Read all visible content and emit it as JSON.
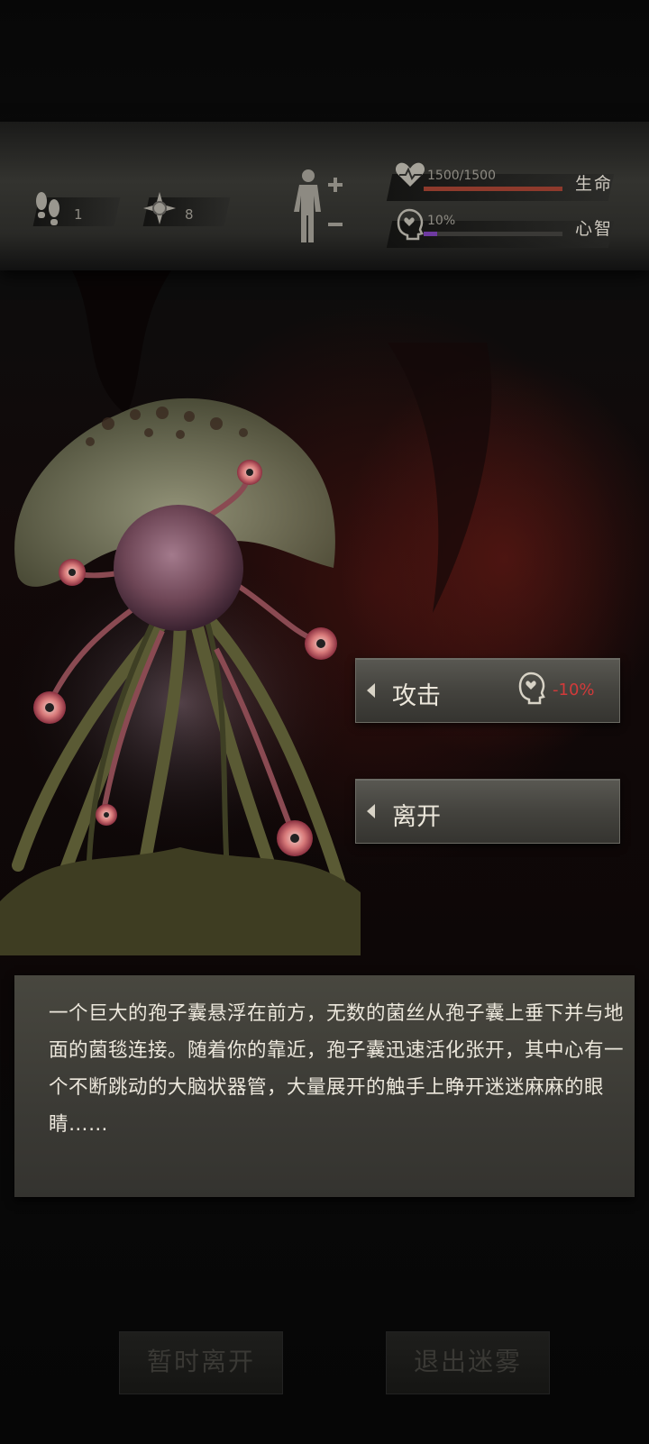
{
  "hud": {
    "steps": {
      "icon": "footprints-icon",
      "value": "1"
    },
    "compass": {
      "icon": "compass-icon",
      "value": "8"
    },
    "character_icon": "character-body-icon",
    "health": {
      "icon": "heart-pulse-icon",
      "text": "1500/1500",
      "label": "生命",
      "fraction": 1.0,
      "color": "#8e3a2c"
    },
    "sanity": {
      "icon": "head-brain-icon",
      "text": "10%",
      "label": "心智",
      "fraction": 0.1,
      "color": "#6e3aa0"
    }
  },
  "choices": [
    {
      "label": "攻击",
      "cost_icon": "head-brain-icon",
      "cost": "-10%"
    },
    {
      "label": "离开"
    }
  ],
  "description": "一个巨大的孢子囊悬浮在前方，无数的菌丝从孢子囊上垂下并与地面的菌毯连接。随着你的靠近，孢子囊迅速活化张开，其中心有一个不断跳动的大脑状器管，大量展开的触手上睁开迷迷麻麻的眼睛……",
  "bottom": {
    "pause_label": "暂时离开",
    "exit_label": "退出迷雾"
  },
  "colors": {
    "cost_red": "#d23a3a"
  }
}
